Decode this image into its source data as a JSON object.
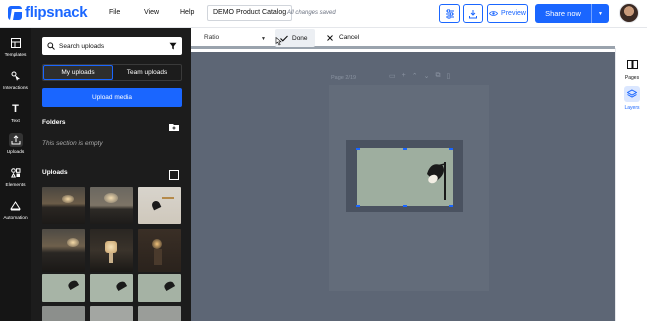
{
  "app": {
    "brand": "flipsnack"
  },
  "header": {
    "menu": [
      "File",
      "View",
      "Help"
    ],
    "doc_title": "DEMO Product Catalog",
    "saved_status": "All changes saved",
    "preview_label": "Preview",
    "share_label": "Share now"
  },
  "rail": {
    "items": [
      {
        "label": "Templates",
        "icon": "templates-icon"
      },
      {
        "label": "Interactions",
        "icon": "interactions-icon"
      },
      {
        "label": "Text",
        "icon": "text-icon"
      },
      {
        "label": "Uploads",
        "icon": "upload-icon"
      },
      {
        "label": "Elements",
        "icon": "elements-icon"
      },
      {
        "label": "Automation",
        "icon": "automation-icon"
      }
    ]
  },
  "uploads_panel": {
    "search_placeholder": "Search uploads",
    "tabs": [
      "My uploads",
      "Team uploads"
    ],
    "upload_button": "Upload media",
    "folders_title": "Folders",
    "folders_empty": "This section is empty",
    "uploads_title": "Uploads"
  },
  "crop_toolbar": {
    "ratio_label": "Ratio",
    "done_label": "Done",
    "cancel_label": "Cancel"
  },
  "canvas": {
    "page_label": "Page 2/19"
  },
  "right_panel": {
    "items": [
      {
        "label": "Pages",
        "icon": "pages-icon"
      },
      {
        "label": "Layers",
        "icon": "layers-icon"
      }
    ]
  },
  "colors": {
    "accent": "#1a66ff",
    "rail_bg": "#151515",
    "panel_bg": "#1c1c1c",
    "canvas_bg": "#5d6675"
  }
}
